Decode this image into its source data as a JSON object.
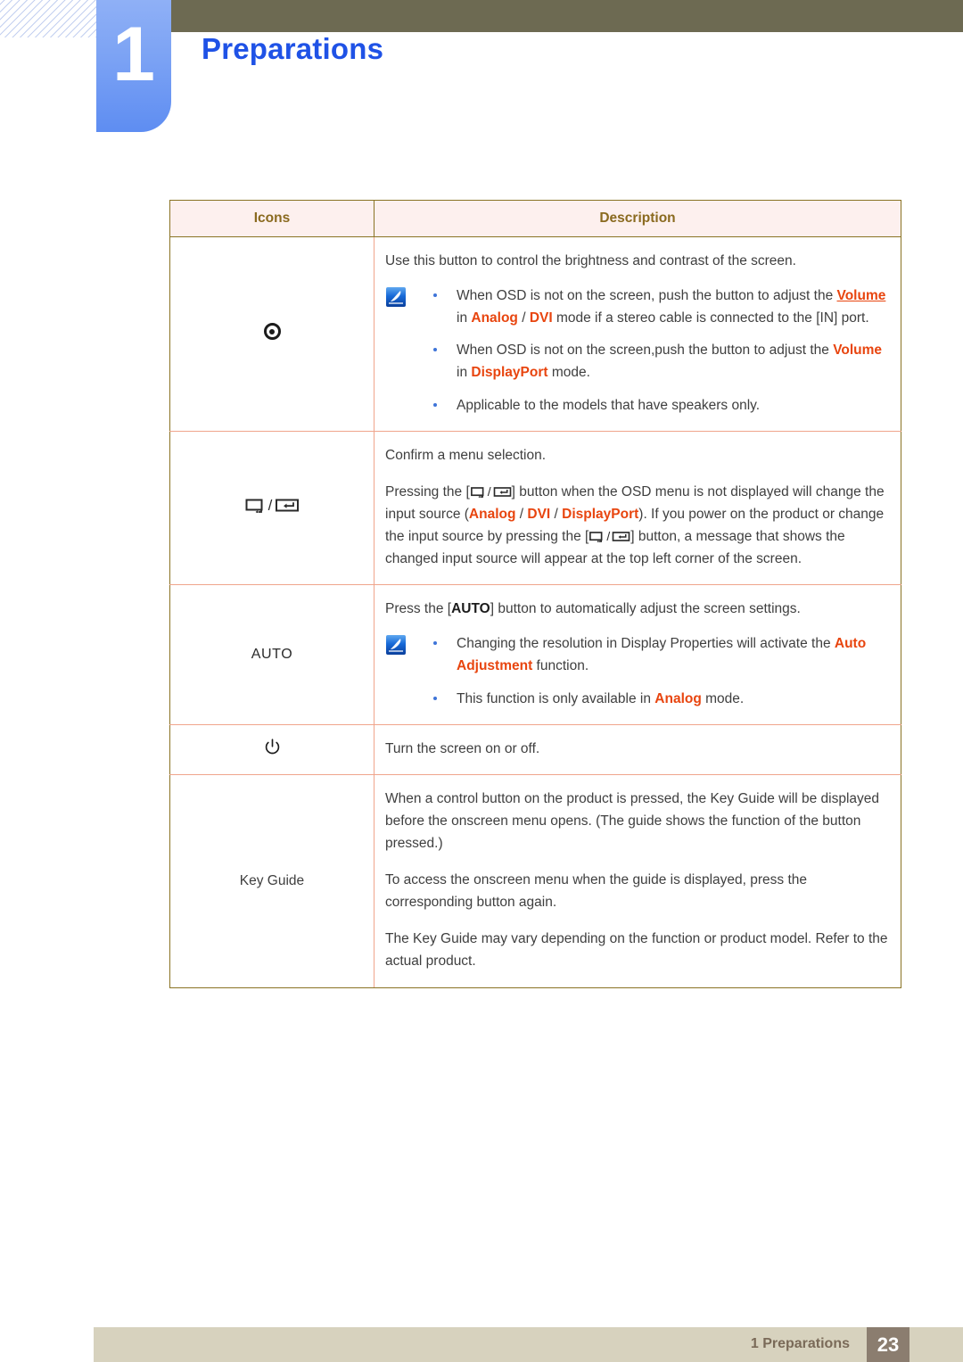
{
  "header": {
    "chapter_number": "1",
    "chapter_title": "Preparations",
    "accent_blue": "#1f52e6",
    "olive": "#6d6a52"
  },
  "table": {
    "columns": [
      "Icons",
      "Description"
    ],
    "rows": [
      {
        "icon_name": "brightness-contrast-icon",
        "icon_label": "",
        "intro": "Use this button to control the brightness and contrast of the screen.",
        "note_icon": "note-pen-icon",
        "bullets": [
          {
            "parts": [
              {
                "t": "When OSD is not on the screen, push the button to adjust the ",
                "s": "plain"
              },
              {
                "t": "Volume",
                "s": "hl-underline"
              },
              {
                "t": " in ",
                "s": "plain"
              },
              {
                "t": "Analog",
                "s": "hl"
              },
              {
                "t": " / ",
                "s": "plain"
              },
              {
                "t": "DVI",
                "s": "hl"
              },
              {
                "t": " mode if a stereo cable is connected to the [IN] port.",
                "s": "plain"
              }
            ]
          },
          {
            "parts": [
              {
                "t": "When OSD is not on the screen,push the button to adjust the ",
                "s": "plain"
              },
              {
                "t": "Volume",
                "s": "hl"
              },
              {
                "t": " in ",
                "s": "plain"
              },
              {
                "t": "DisplayPort",
                "s": "hl"
              },
              {
                "t": " mode.",
                "s": "plain"
              }
            ]
          },
          {
            "parts": [
              {
                "t": "Applicable to the models that have speakers only.",
                "s": "plain"
              }
            ]
          }
        ]
      },
      {
        "icon_name": "source-enter-icon",
        "icon_label": "",
        "paragraph_1": "Confirm a menu selection.",
        "paragraph_2_parts": [
          {
            "t": "Pressing the [",
            "s": "plain"
          },
          {
            "t": "KEYGLYPH",
            "s": "key"
          },
          {
            "t": "] button when the OSD menu is not displayed will change the input source (",
            "s": "plain"
          },
          {
            "t": "Analog",
            "s": "hl"
          },
          {
            "t": " / ",
            "s": "plain"
          },
          {
            "t": "DVI",
            "s": "hl"
          },
          {
            "t": " / ",
            "s": "plain"
          },
          {
            "t": "DisplayPort",
            "s": "hl"
          },
          {
            "t": "). If you power on the product or change the input source by pressing the [",
            "s": "plain"
          },
          {
            "t": "KEYGLYPH",
            "s": "key"
          },
          {
            "t": "] button, a message that shows the changed input source will appear at the top left corner of the screen.",
            "s": "plain"
          }
        ]
      },
      {
        "icon_name": "auto-button-icon",
        "icon_label": "AUTO",
        "intro_parts": [
          {
            "t": "Press the [",
            "s": "plain"
          },
          {
            "t": "AUTO",
            "s": "bold-dark"
          },
          {
            "t": "] button to automatically adjust the screen settings.",
            "s": "plain"
          }
        ],
        "note_icon": "note-pen-icon",
        "bullets": [
          {
            "parts": [
              {
                "t": "Changing the resolution in Display Properties will activate the ",
                "s": "plain"
              },
              {
                "t": "Auto Adjustment",
                "s": "hl"
              },
              {
                "t": " function.",
                "s": "plain"
              }
            ]
          },
          {
            "parts": [
              {
                "t": "This function is only available in ",
                "s": "plain"
              },
              {
                "t": "Analog",
                "s": "hl"
              },
              {
                "t": " mode.",
                "s": "plain"
              }
            ]
          }
        ]
      },
      {
        "icon_name": "power-icon",
        "icon_label": "",
        "paragraph_1": "Turn the screen on or off."
      },
      {
        "icon_name": "key-guide-label",
        "icon_label": "Key Guide",
        "paragraph_1": "When a control button on the product is pressed, the Key Guide will be displayed before the onscreen menu opens. (The guide shows the function of the button pressed.)",
        "paragraph_2": "To access the onscreen menu when the guide is displayed, press the corresponding button again.",
        "paragraph_3": "The Key Guide may vary depending on the function or product model. Refer to the actual product."
      }
    ]
  },
  "footer": {
    "label": "1 Preparations",
    "page_number": "23"
  }
}
